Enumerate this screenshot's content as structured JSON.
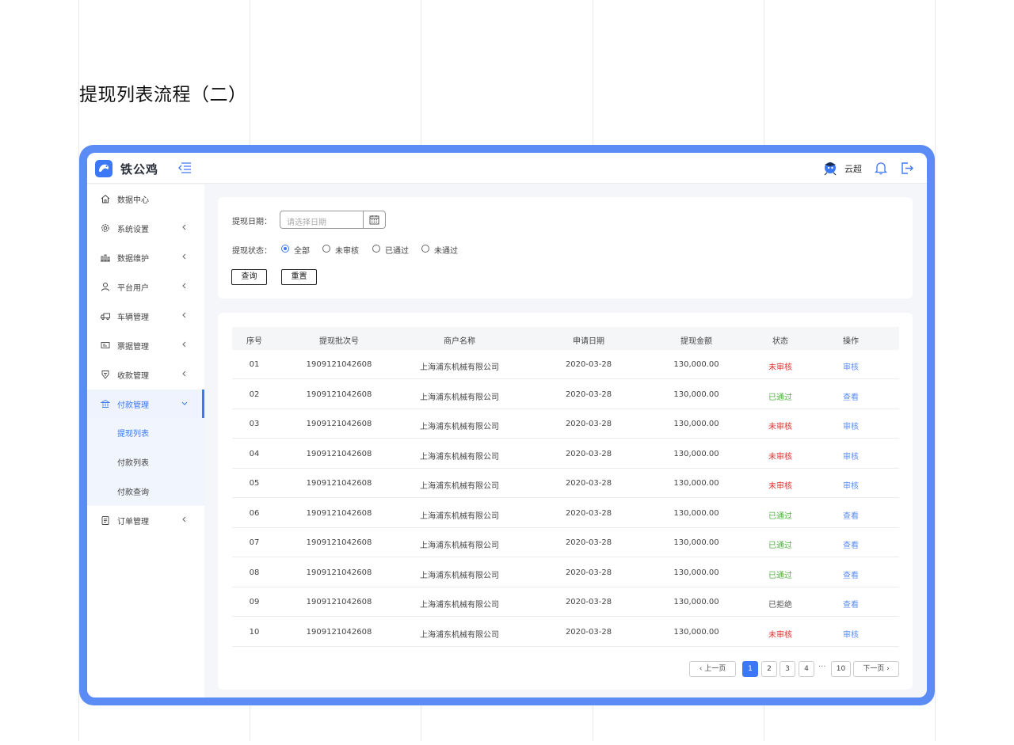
{
  "page": {
    "title": "提现列表流程（二）"
  },
  "header": {
    "brand": "铁公鸡",
    "user_name": "云超"
  },
  "sidebar": {
    "items": [
      {
        "label": "数据中心",
        "icon": "home-icon"
      },
      {
        "label": "系统设置",
        "icon": "gear-icon"
      },
      {
        "label": "数据维护",
        "icon": "bars-icon"
      },
      {
        "label": "平台用户",
        "icon": "user-icon"
      },
      {
        "label": "车辆管理",
        "icon": "truck-icon"
      },
      {
        "label": "票据管理",
        "icon": "ticket-icon"
      },
      {
        "label": "收款管理",
        "icon": "receive-icon"
      },
      {
        "label": "付款管理",
        "icon": "payment-icon"
      },
      {
        "label": "订单管理",
        "icon": "clipboard-icon"
      }
    ],
    "sub_items": [
      "提现列表",
      "付款列表",
      "付款查询"
    ]
  },
  "filter": {
    "date_label": "提现日期：",
    "date_placeholder": "请选择日期",
    "status_label": "提现状态：",
    "status_options": [
      "全部",
      "未审核",
      "已通过",
      "未通过"
    ],
    "selected_status": "全部",
    "query_button": "查询",
    "reset_button": "重置"
  },
  "table": {
    "columns": [
      "序号",
      "提现批次号",
      "商户名称",
      "申请日期",
      "提现金额",
      "状态",
      "操作"
    ],
    "rows": [
      {
        "no": "01",
        "batch": "1909121042608",
        "merchant": "上海浦东机械有限公司",
        "date": "2020-03-28",
        "amount": "130,000.00",
        "status": "未审核",
        "action": "审核"
      },
      {
        "no": "02",
        "batch": "1909121042608",
        "merchant": "上海浦东机械有限公司",
        "date": "2020-03-28",
        "amount": "130,000.00",
        "status": "已通过",
        "action": "查看"
      },
      {
        "no": "03",
        "batch": "1909121042608",
        "merchant": "上海浦东机械有限公司",
        "date": "2020-03-28",
        "amount": "130,000.00",
        "status": "未审核",
        "action": "审核"
      },
      {
        "no": "04",
        "batch": "1909121042608",
        "merchant": "上海浦东机械有限公司",
        "date": "2020-03-28",
        "amount": "130,000.00",
        "status": "未审核",
        "action": "审核"
      },
      {
        "no": "05",
        "batch": "1909121042608",
        "merchant": "上海浦东机械有限公司",
        "date": "2020-03-28",
        "amount": "130,000.00",
        "status": "未审核",
        "action": "审核"
      },
      {
        "no": "06",
        "batch": "1909121042608",
        "merchant": "上海浦东机械有限公司",
        "date": "2020-03-28",
        "amount": "130,000.00",
        "status": "已通过",
        "action": "查看"
      },
      {
        "no": "07",
        "batch": "1909121042608",
        "merchant": "上海浦东机械有限公司",
        "date": "2020-03-28",
        "amount": "130,000.00",
        "status": "已通过",
        "action": "查看"
      },
      {
        "no": "08",
        "batch": "1909121042608",
        "merchant": "上海浦东机械有限公司",
        "date": "2020-03-28",
        "amount": "130,000.00",
        "status": "已通过",
        "action": "查看"
      },
      {
        "no": "09",
        "batch": "1909121042608",
        "merchant": "上海浦东机械有限公司",
        "date": "2020-03-28",
        "amount": "130,000.00",
        "status": "已拒绝",
        "action": "查看"
      },
      {
        "no": "10",
        "batch": "1909121042608",
        "merchant": "上海浦东机械有限公司",
        "date": "2020-03-28",
        "amount": "130,000.00",
        "status": "未审核",
        "action": "审核"
      }
    ]
  },
  "pagination": {
    "prev": "上一页",
    "next": "下一页",
    "pages": [
      "1",
      "2",
      "3",
      "4"
    ],
    "ellipsis": "···",
    "last": "10",
    "current": "1"
  },
  "colors": {
    "accent": "#3c78f5",
    "frame": "#5b8cf6",
    "pending": "#e0322f",
    "passed": "#52b043"
  }
}
